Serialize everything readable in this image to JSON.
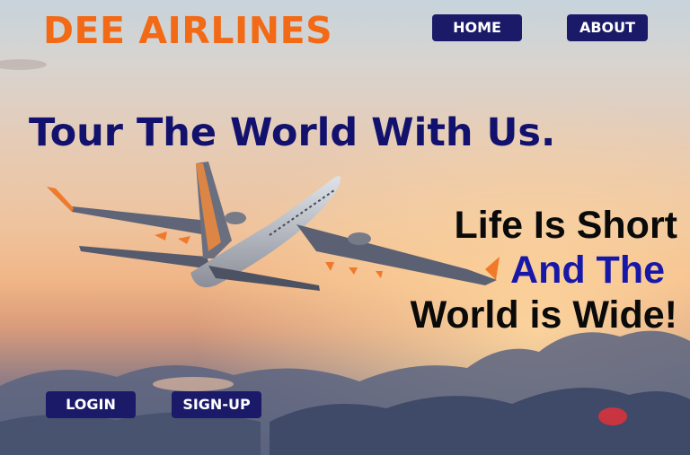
{
  "header": {
    "brand": "DEE AIRLINES",
    "nav": [
      {
        "label": "HOME"
      },
      {
        "label": "ABOUT"
      }
    ]
  },
  "hero": {
    "headline": "Tour The World With Us.",
    "tagline": {
      "line1": "Life Is Short",
      "line2": "And The",
      "line3": "World is Wide!"
    }
  },
  "auth": {
    "login_label": "LOGIN",
    "signup_label": "SIGN-UP"
  },
  "colors": {
    "brand": "#f26a16",
    "nav_button": "#1a1a68",
    "headline": "#12126e",
    "tagline_accent": "#1818a8"
  }
}
